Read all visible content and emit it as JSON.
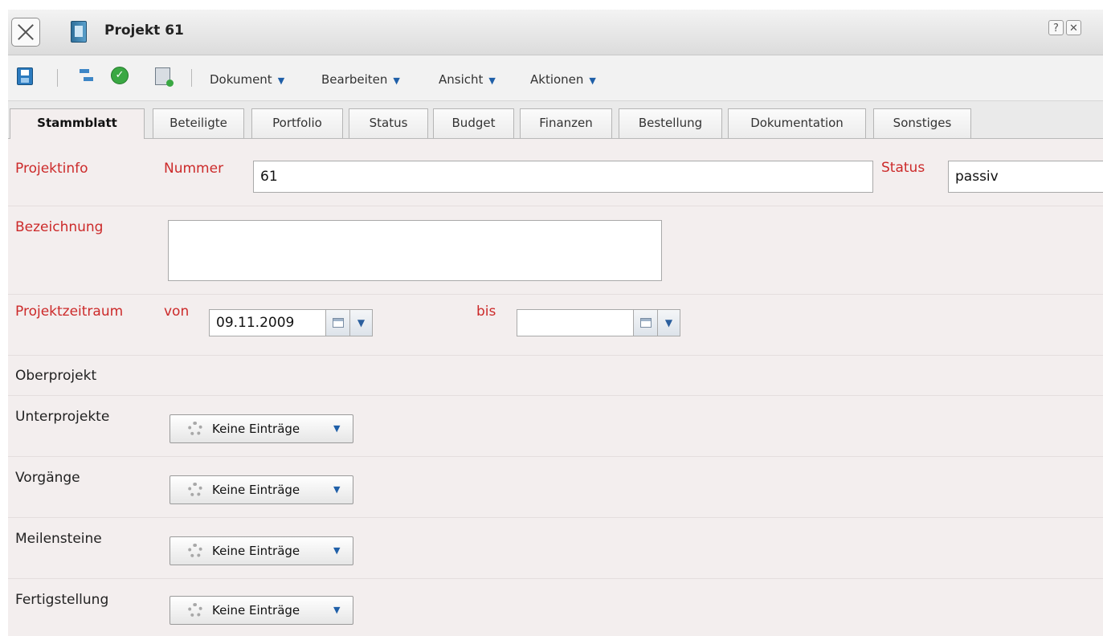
{
  "window": {
    "title": "Projekt 61",
    "help_label": "?",
    "close_label": "✕"
  },
  "toolbar": {
    "menus": [
      {
        "label": "Dokument",
        "arrow": "▼"
      },
      {
        "label": "Bearbeiten",
        "arrow": "▼"
      },
      {
        "label": "Ansicht",
        "arrow": "▼"
      },
      {
        "label": "Aktionen",
        "arrow": "▼"
      }
    ],
    "icons": [
      "save-icon",
      "hierarchy-icon",
      "check-icon",
      "calculator-icon"
    ]
  },
  "tabs": [
    {
      "label": "Stammblatt",
      "active": true
    },
    {
      "label": "Beteiligte"
    },
    {
      "label": "Portfolio"
    },
    {
      "label": "Status"
    },
    {
      "label": "Budget"
    },
    {
      "label": "Finanzen"
    },
    {
      "label": "Bestellung"
    },
    {
      "label": "Dokumentation"
    },
    {
      "label": "Sonstiges"
    }
  ],
  "form": {
    "projektinfo_label": "Projektinfo",
    "nummer_label": "Nummer",
    "nummer_value": "61",
    "status_label": "Status",
    "status_value": "passiv",
    "bezeichnung_label": "Bezeichnung",
    "bezeichnung_value": "",
    "zeitraum_label": "Projektzeitraum",
    "von_label": "von",
    "von_value": "09.11.2009",
    "bis_label": "bis",
    "bis_value": "",
    "oberprojekt_label": "Oberprojekt",
    "unterprojekte_label": "Unterprojekte",
    "vorgaenge_label": "Vorgänge",
    "meilensteine_label": "Meilensteine",
    "fertigstellung_label": "Fertigstellung",
    "keine_eintraege": "Keine Einträge",
    "dropdown_arrow": "▼"
  },
  "colors": {
    "required_label": "#cc2a2a",
    "form_background": "#f3eeee",
    "accent_blue": "#1f5fa8"
  }
}
